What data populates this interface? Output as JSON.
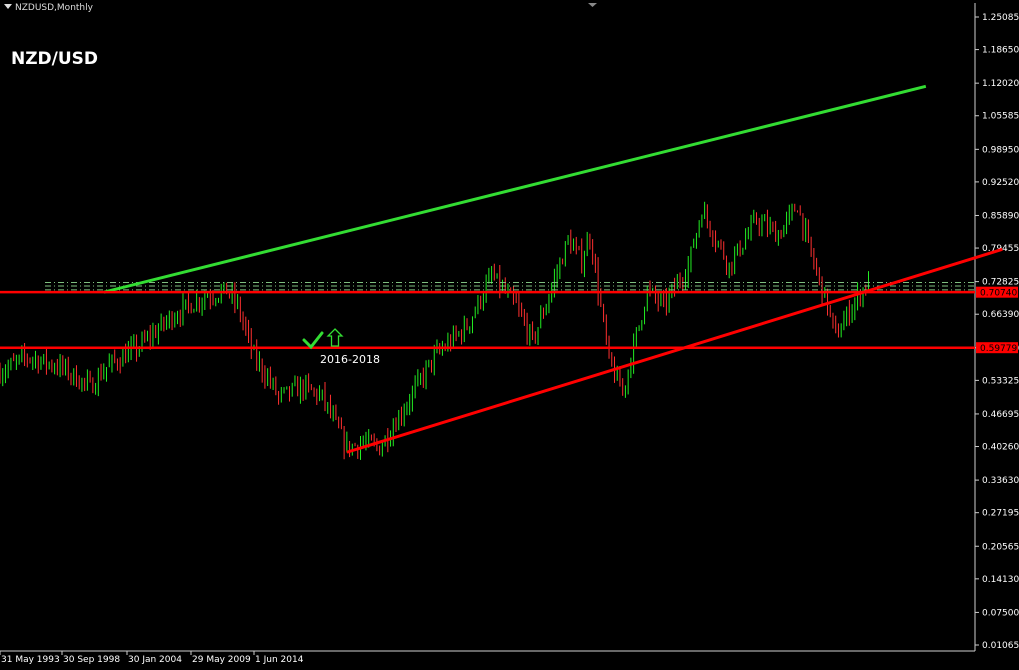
{
  "window": {
    "header": "NZDUSD,Monthly",
    "title": "NZD/USD"
  },
  "colors": {
    "background": "#000000",
    "bull_candle": "#22ee22",
    "bear_candle": "#ff3030",
    "upper_channel": "#33dd33",
    "support_lines": "#ff0000",
    "dashed_levels": "#7fbf7f",
    "axis_text": "#ffffff"
  },
  "chart_data": {
    "type": "candlestick",
    "symbol": "NZDUSD",
    "timeframe": "Monthly",
    "title": "NZD/USD",
    "ylim": [
      0.0106,
      1.2861
    ],
    "y_ticks": [
      "1.25085",
      "1.18650",
      "1.12020",
      "1.05585",
      "0.98950",
      "0.92520",
      "0.85890",
      "0.79455",
      "0.72825",
      "0.66390",
      "0.59760",
      "0.53325",
      "0.46695",
      "0.40260",
      "0.33630",
      "0.27195",
      "0.20565",
      "0.14130",
      "0.07500",
      "0.01065"
    ],
    "x_ticks": [
      "31 May 1993",
      "30 Sep 1998",
      "30 Jan 2004",
      "29 May 2009",
      "1 Jun 2014"
    ],
    "x_range": [
      "1990-03",
      "2019-12"
    ],
    "price_series": [
      [
        "1990-03",
        0.55
      ],
      [
        "1991-01",
        0.58
      ],
      [
        "1992-01",
        0.56
      ],
      [
        "1992-12",
        0.52
      ],
      [
        "1993-06",
        0.56
      ],
      [
        "1994-06",
        0.6
      ],
      [
        "1995-06",
        0.66
      ],
      [
        "1996-06",
        0.7
      ],
      [
        "1997-02",
        0.71
      ],
      [
        "1997-06",
        0.68
      ],
      [
        "1997-12",
        0.58
      ],
      [
        "1998-06",
        0.53
      ],
      [
        "1998-09",
        0.5
      ],
      [
        "1999-06",
        0.52
      ],
      [
        "2000-01",
        0.5
      ],
      [
        "2000-10",
        0.4
      ],
      [
        "2001-04",
        0.41
      ],
      [
        "2001-10",
        0.4
      ],
      [
        "2002-06",
        0.47
      ],
      [
        "2003-06",
        0.58
      ],
      [
        "2004-06",
        0.64
      ],
      [
        "2005-03",
        0.74
      ],
      [
        "2005-12",
        0.68
      ],
      [
        "2006-06",
        0.61
      ],
      [
        "2006-12",
        0.7
      ],
      [
        "2007-07",
        0.81
      ],
      [
        "2007-12",
        0.77
      ],
      [
        "2008-03",
        0.82
      ],
      [
        "2008-10",
        0.57
      ],
      [
        "2009-03",
        0.51
      ],
      [
        "2009-12",
        0.71
      ],
      [
        "2010-06",
        0.68
      ],
      [
        "2011-03",
        0.76
      ],
      [
        "2011-08",
        0.87
      ],
      [
        "2012-06",
        0.76
      ],
      [
        "2013-04",
        0.85
      ],
      [
        "2013-12",
        0.82
      ],
      [
        "2014-07",
        0.88
      ],
      [
        "2014-12",
        0.78
      ],
      [
        "2015-06",
        0.68
      ],
      [
        "2015-09",
        0.62
      ],
      [
        "2016-03",
        0.68
      ],
      [
        "2016-09",
        0.73
      ]
    ],
    "lines": [
      {
        "name": "upper channel",
        "color": "#33dd33",
        "from": [
          "1993-05",
          0.7074
        ],
        "to": [
          "2018-06",
          1.114
        ]
      },
      {
        "name": "rising support",
        "color": "#ff0000",
        "from": [
          "2000-10",
          0.3913
        ],
        "to": [
          "2020-10",
          0.792
        ]
      },
      {
        "name": "resistance",
        "color": "#ff0000",
        "level": 0.7074
      },
      {
        "name": "support",
        "color": "#ff0000",
        "level": 0.59779
      }
    ],
    "dashed_levels": [
      0.7265,
      0.7196,
      0.712
    ],
    "price_labels": [
      "0.70740",
      "0.59779"
    ],
    "annotations": [
      {
        "text": "2016-2018",
        "at": [
          "2016-03",
          0.558
        ]
      }
    ],
    "grid": false,
    "legend": "none"
  }
}
